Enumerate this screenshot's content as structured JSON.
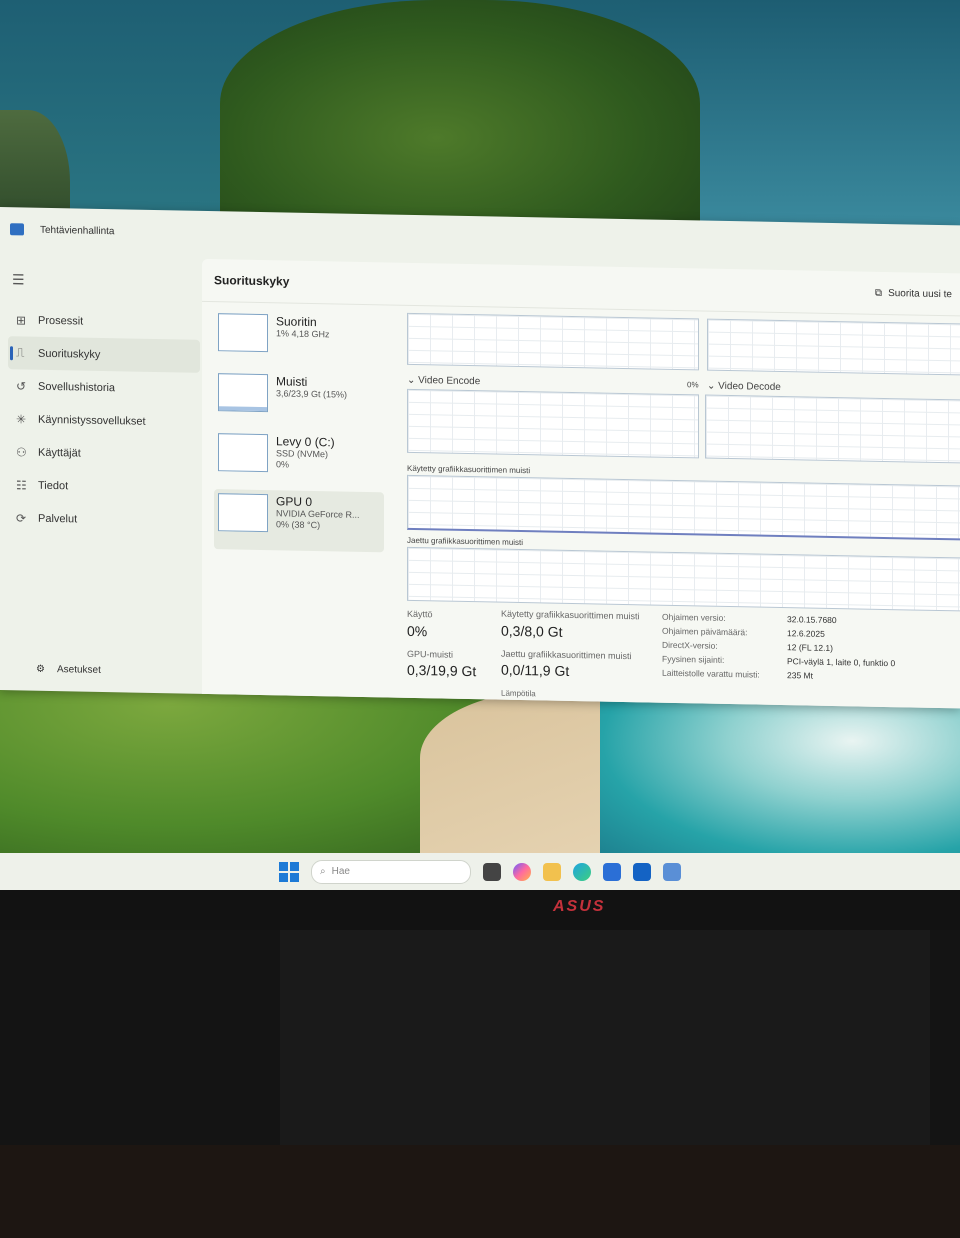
{
  "window": {
    "title": "Tehtävienhallinta"
  },
  "sidebar": {
    "items": [
      {
        "label": "Prosessit",
        "icon": "processes-icon",
        "active": false
      },
      {
        "label": "Suorituskyky",
        "icon": "performance-icon",
        "active": true
      },
      {
        "label": "Sovellushistoria",
        "icon": "history-icon",
        "active": false
      },
      {
        "label": "Käynnistyssovellukset",
        "icon": "startup-icon",
        "active": false
      },
      {
        "label": "Käyttäjät",
        "icon": "users-icon",
        "active": false
      },
      {
        "label": "Tiedot",
        "icon": "details-icon",
        "active": false
      },
      {
        "label": "Palvelut",
        "icon": "services-icon",
        "active": false
      }
    ],
    "settings_label": "Asetukset"
  },
  "header": {
    "title": "Suorituskyky",
    "run_task_label": "Suorita uusi te"
  },
  "devices": [
    {
      "name": "Suoritin",
      "sub1": "1% 4,18 GHz",
      "sub2": ""
    },
    {
      "name": "Muisti",
      "sub1": "3,6/23,9 Gt (15%)",
      "sub2": ""
    },
    {
      "name": "Levy 0 (C:)",
      "sub1": "SSD (NVMe)",
      "sub2": "0%"
    },
    {
      "name": "GPU 0",
      "sub1": "NVIDIA GeForce R...",
      "sub2": "0% (38 °C)"
    }
  ],
  "graphs": {
    "video_encode": "Video Encode",
    "video_encode_pct": "0%",
    "video_decode": "Video Decode",
    "dedicated_mem": "Käytetty grafiikkasuorittimen muisti",
    "shared_mem": "Jaettu grafiikkasuorittimen muisti"
  },
  "stats": {
    "utilization_label": "Käyttö",
    "utilization_value": "0%",
    "dedicated_label": "Käytetty grafiikkasuorittimen muisti",
    "dedicated_value": "0,3/8,0 Gt",
    "gpu_mem_label": "GPU-muisti",
    "gpu_mem_value": "0,3/19,9 Gt",
    "shared_label": "Jaettu grafiikkasuorittimen muisti",
    "shared_value": "0,0/11,9 Gt",
    "temp_label": "Lämpötila"
  },
  "properties": [
    {
      "label": "Ohjaimen versio:",
      "value": "32.0.15.7680"
    },
    {
      "label": "Ohjaimen päivämäärä:",
      "value": "12.6.2025"
    },
    {
      "label": "DirectX-versio:",
      "value": "12 (FL 12.1)"
    },
    {
      "label": "Fyysinen sijainti:",
      "value": "PCI-väylä 1, laite 0, funktio 0"
    },
    {
      "label": "Laitteistolle varattu muisti:",
      "value": "235 Mt"
    }
  ],
  "taskbar": {
    "search_placeholder": "Hae"
  },
  "monitor": {
    "brand": "ASUS"
  }
}
